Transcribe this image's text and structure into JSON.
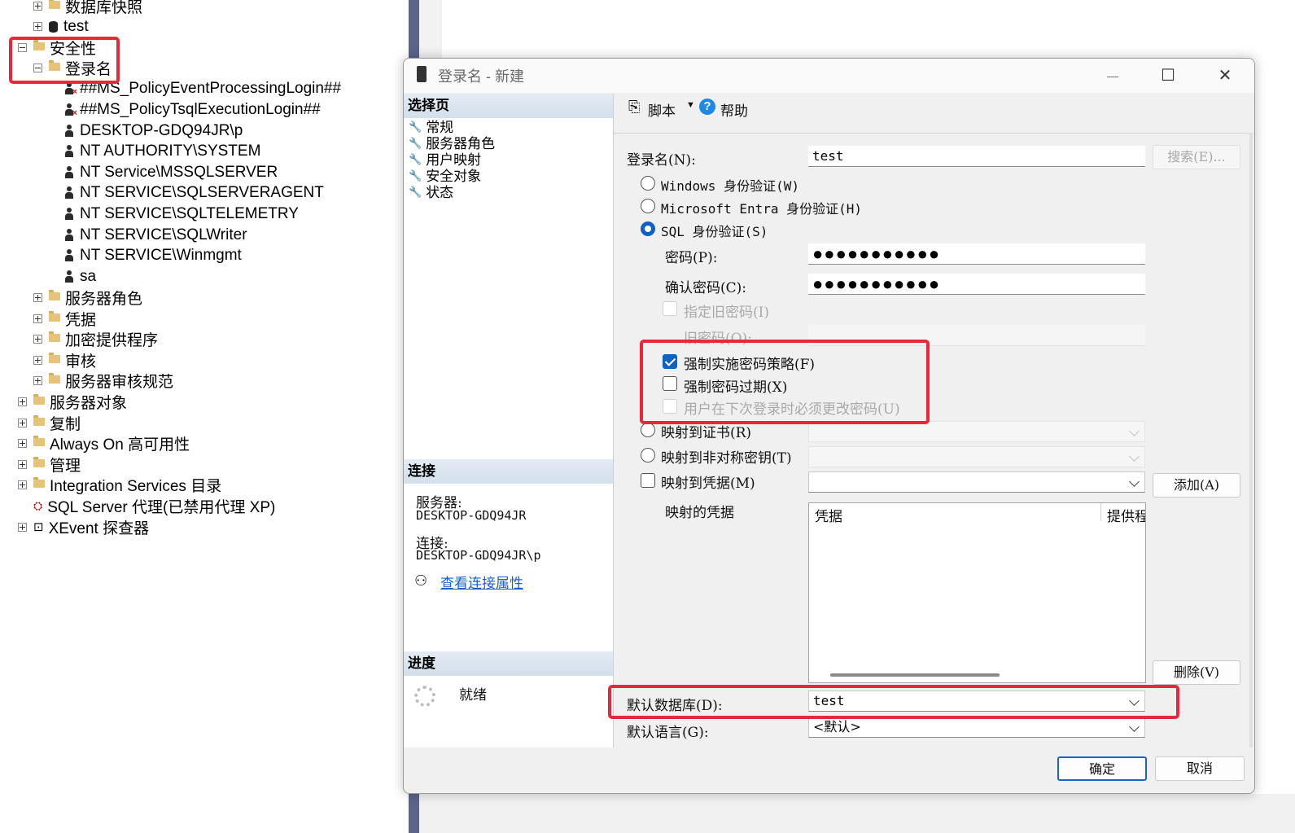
{
  "tree": {
    "items": [
      {
        "label": "数据库快照",
        "icon": "folder-icon",
        "exp": "plus",
        "indent": 1
      },
      {
        "label": "test",
        "icon": "database-icon",
        "exp": "plus",
        "indent": 1
      },
      {
        "label": "安全性",
        "icon": "folder-icon",
        "exp": "minus",
        "indent": 0
      },
      {
        "label": "登录名",
        "icon": "folder-icon",
        "exp": "minus",
        "indent": 1
      },
      {
        "label": "##MS_PolicyEventProcessingLogin##",
        "icon": "disabled-user-icon",
        "exp": "",
        "indent": 2
      },
      {
        "label": "##MS_PolicyTsqlExecutionLogin##",
        "icon": "disabled-user-icon",
        "exp": "",
        "indent": 2
      },
      {
        "label": "DESKTOP-GDQ94JR\\p",
        "icon": "user-icon",
        "exp": "",
        "indent": 2
      },
      {
        "label": "NT AUTHORITY\\SYSTEM",
        "icon": "user-icon",
        "exp": "",
        "indent": 2
      },
      {
        "label": "NT Service\\MSSQLSERVER",
        "icon": "user-icon",
        "exp": "",
        "indent": 2
      },
      {
        "label": "NT SERVICE\\SQLSERVERAGENT",
        "icon": "user-icon",
        "exp": "",
        "indent": 2
      },
      {
        "label": "NT SERVICE\\SQLTELEMETRY",
        "icon": "user-icon",
        "exp": "",
        "indent": 2
      },
      {
        "label": "NT SERVICE\\SQLWriter",
        "icon": "user-icon",
        "exp": "",
        "indent": 2
      },
      {
        "label": "NT SERVICE\\Winmgmt",
        "icon": "user-icon",
        "exp": "",
        "indent": 2
      },
      {
        "label": "sa",
        "icon": "user-icon",
        "exp": "",
        "indent": 2
      },
      {
        "label": "服务器角色",
        "icon": "folder-icon",
        "exp": "plus",
        "indent": 1
      },
      {
        "label": "凭据",
        "icon": "folder-icon",
        "exp": "plus",
        "indent": 1
      },
      {
        "label": "加密提供程序",
        "icon": "folder-icon",
        "exp": "plus",
        "indent": 1
      },
      {
        "label": "审核",
        "icon": "folder-icon",
        "exp": "plus",
        "indent": 1
      },
      {
        "label": "服务器审核规范",
        "icon": "folder-icon",
        "exp": "plus",
        "indent": 1
      },
      {
        "label": "服务器对象",
        "icon": "folder-icon",
        "exp": "plus",
        "indent": 0
      },
      {
        "label": "复制",
        "icon": "folder-icon",
        "exp": "plus",
        "indent": 0
      },
      {
        "label": "Always On 高可用性",
        "icon": "folder-icon",
        "exp": "plus",
        "indent": 0
      },
      {
        "label": "管理",
        "icon": "folder-icon",
        "exp": "plus",
        "indent": 0
      },
      {
        "label": "Integration Services 目录",
        "icon": "folder-icon",
        "exp": "plus",
        "indent": 0
      },
      {
        "label": "SQL Server 代理(已禁用代理 XP)",
        "icon": "agent-icon",
        "exp": "",
        "indent": 0
      },
      {
        "label": "XEvent 探查器",
        "icon": "xevent-icon",
        "exp": "plus",
        "indent": 0
      }
    ]
  },
  "dialog": {
    "title": "登录名 - 新建",
    "window_buttons": {
      "minimize": "—",
      "maximize": "☐",
      "close": "✕"
    },
    "select_page": {
      "header": "选择页",
      "items": [
        "常规",
        "服务器角色",
        "用户映射",
        "安全对象",
        "状态"
      ]
    },
    "connection": {
      "header": "连接",
      "server_label": "服务器:",
      "server_value": "DESKTOP-GDQ94JR",
      "conn_label": "连接:",
      "conn_value": "DESKTOP-GDQ94JR\\p",
      "link": "查看连接属性"
    },
    "progress": {
      "header": "进度",
      "status": "就绪"
    },
    "toolbar": {
      "script": "脚本",
      "help": "帮助"
    },
    "form": {
      "login_label": "登录名(N):",
      "login_value": "test",
      "search_button": "搜索(E)...",
      "auth_windows": "Windows 身份验证(W)",
      "auth_entra": "Microsoft Entra 身份验证(H)",
      "auth_sql": "SQL 身份验证(S)",
      "selected_auth": "sql",
      "password_label": "密码(P):",
      "password_value": "●●●●●●●●●●●",
      "confirm_label": "确认密码(C):",
      "confirm_value": "●●●●●●●●●●●",
      "old_pwd_check": "指定旧密码(I)",
      "old_pwd_label": "旧密码(O):",
      "enforce_policy": "强制实施密码策略(F)",
      "enforce_policy_checked": true,
      "enforce_expiration": "强制密码过期(X)",
      "enforce_expiration_checked": false,
      "must_change": "用户在下次登录时必须更改密码(U)",
      "map_cert": "映射到证书(R)",
      "map_asym": "映射到非对称密钥(T)",
      "map_cred": "映射到凭据(M)",
      "add_button": "添加(A)",
      "mapped_creds_label": "映射的凭据",
      "grid_col_cred": "凭据",
      "grid_col_provider": "提供程",
      "remove_button": "删除(V)",
      "default_db_label": "默认数据库(D):",
      "default_db_value": "test",
      "default_lang_label": "默认语言(G):",
      "default_lang_value": "<默认>"
    },
    "ok_button": "确定",
    "cancel_button": "取消"
  },
  "colors": {
    "highlight_red": "#e8283a",
    "accent_blue": "#0f62c4",
    "link_blue": "#1a5fd6"
  }
}
